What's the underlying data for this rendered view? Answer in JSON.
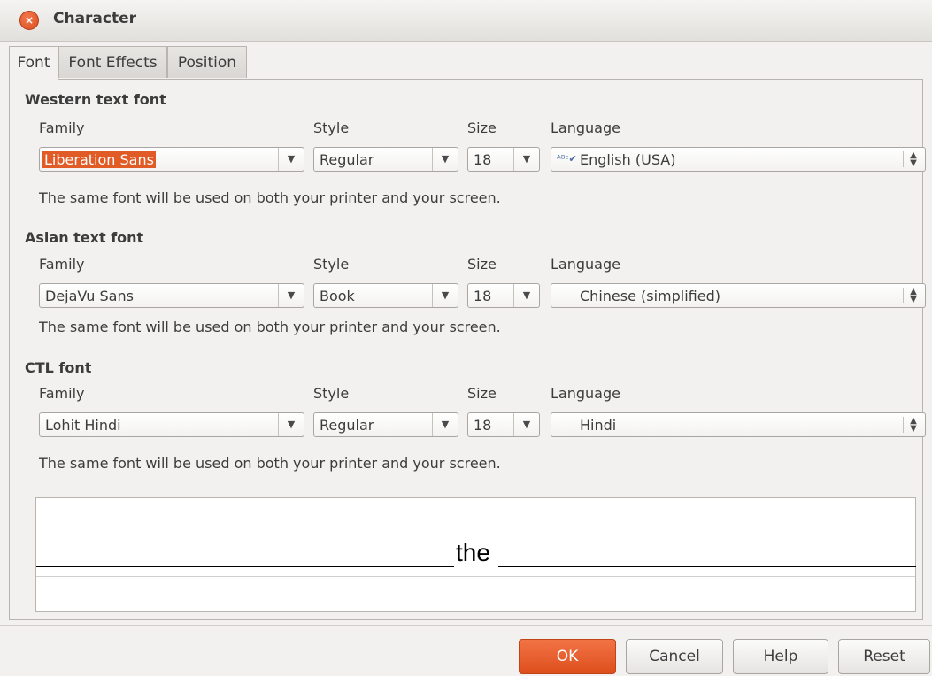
{
  "window": {
    "title": "Character",
    "close_glyph": "×"
  },
  "tabs": [
    {
      "label": "Font",
      "active": true
    },
    {
      "label": "Font Effects",
      "active": false
    },
    {
      "label": "Position",
      "active": false
    }
  ],
  "column_labels": {
    "family": "Family",
    "style": "Style",
    "size": "Size",
    "language": "Language"
  },
  "western": {
    "title": "Western text font",
    "family": "Liberation Sans",
    "style": "Regular",
    "size": "18",
    "language": "English (USA)",
    "language_icon": "spellcheck-icon",
    "note": "The same font will be used on both your printer and your screen."
  },
  "asian": {
    "title": "Asian text font",
    "family": "DejaVu Sans",
    "style": "Book",
    "size": "18",
    "language": "Chinese (simplified)",
    "note": "The same font will be used on both your printer and your screen."
  },
  "ctl": {
    "title": "CTL font",
    "family": "Lohit Hindi",
    "style": "Regular",
    "size": "18",
    "language": "Hindi",
    "note": "The same font will be used on both your printer and your screen."
  },
  "preview": {
    "text": "the"
  },
  "buttons": {
    "ok": "OK",
    "cancel": "Cancel",
    "help": "Help",
    "reset": "Reset"
  },
  "colors": {
    "accent": "#e15b26",
    "background": "#f2f1f0"
  }
}
